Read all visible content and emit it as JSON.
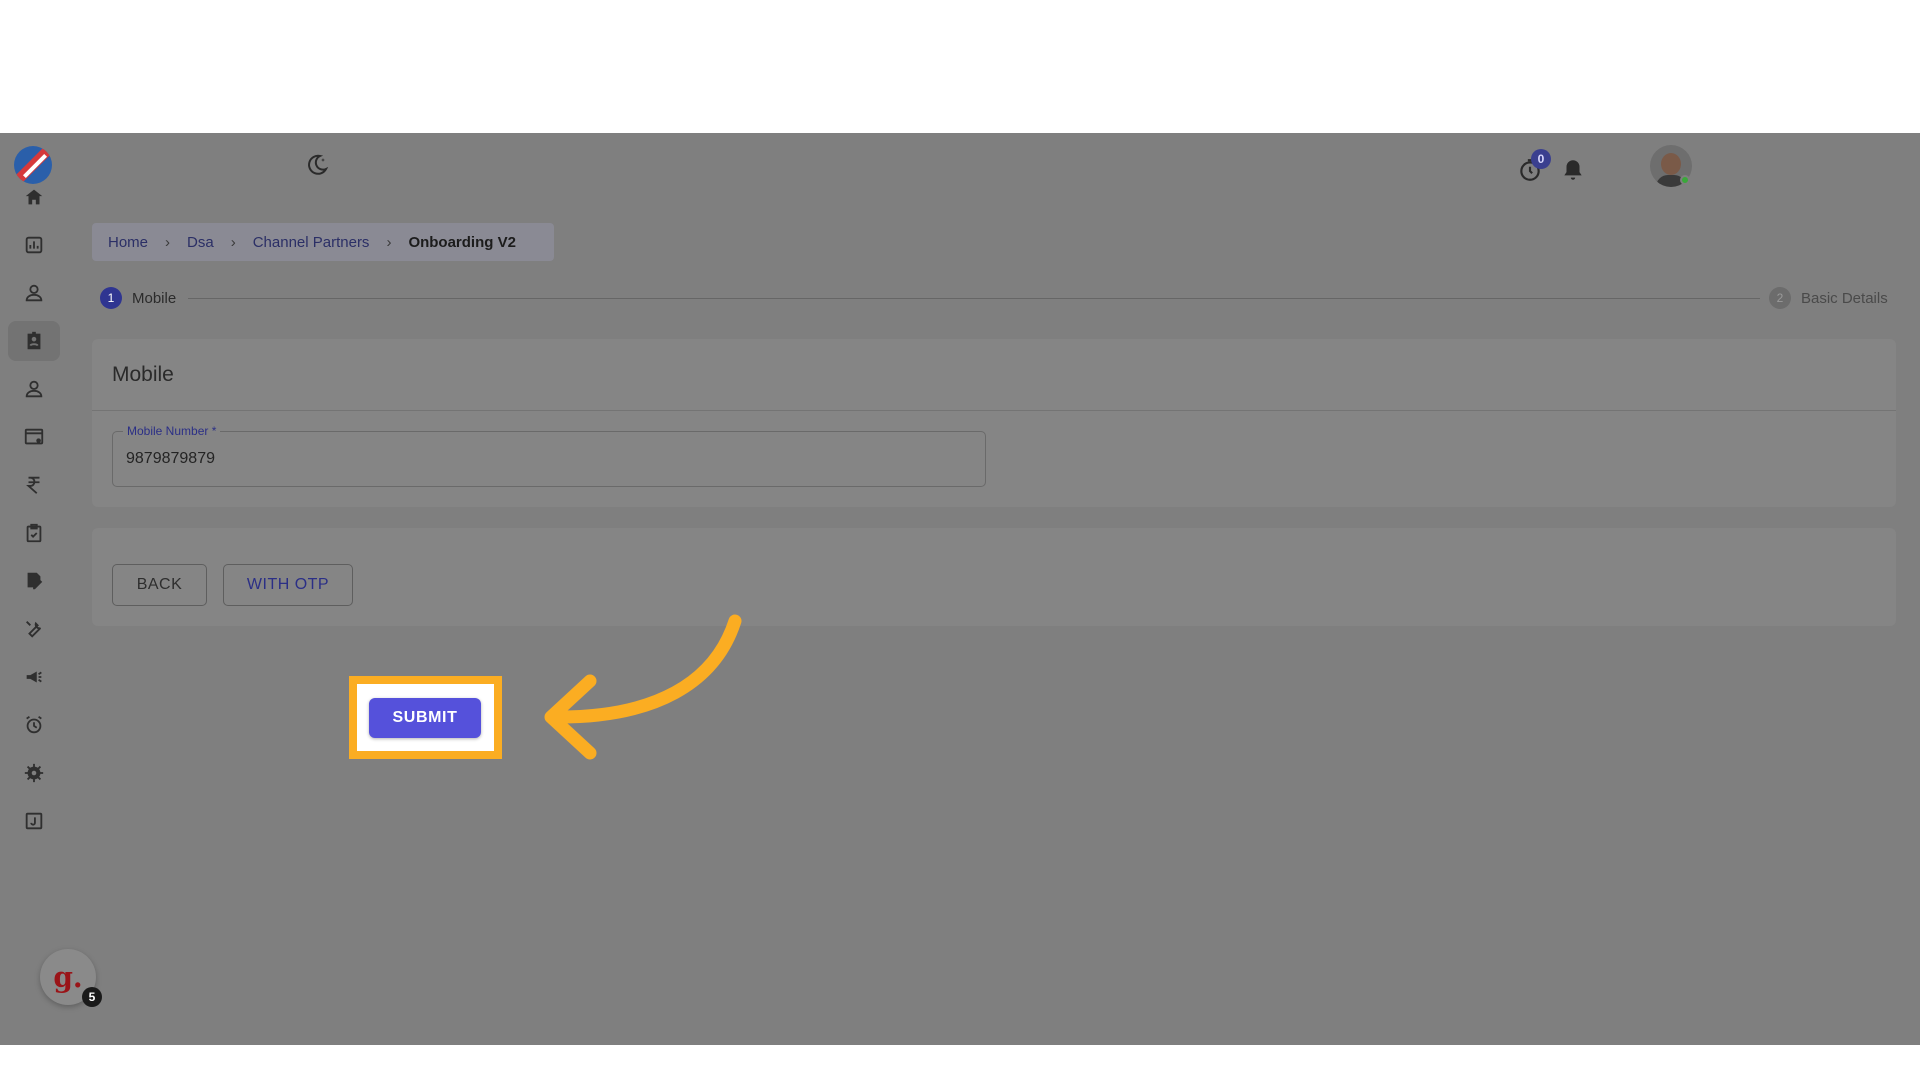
{
  "header": {
    "timer_count": "0"
  },
  "breadcrumb": {
    "items": [
      "Home",
      "Dsa",
      "Channel Partners"
    ],
    "current": "Onboarding V2"
  },
  "stepper": {
    "steps": [
      {
        "number": "1",
        "label": "Mobile"
      },
      {
        "number": "2",
        "label": "Basic Details"
      }
    ]
  },
  "mobile_card": {
    "title": "Mobile",
    "field_label": "Mobile Number *",
    "field_value": "9879879879"
  },
  "actions": {
    "back_label": "BACK",
    "otp_label": "WITH OTP",
    "submit_label": "SUBMIT"
  },
  "widget": {
    "letter": "g.",
    "badge": "5"
  },
  "colors": {
    "overlay": "#7f7f7f",
    "primary": "#5551db",
    "highlight": "#fbad22"
  },
  "icons": {
    "sidebar": [
      "home-icon",
      "dashboard-icon",
      "user-icon",
      "badge-icon",
      "person-icon",
      "settings-window-icon",
      "rupee-icon",
      "clipboard-check-icon",
      "edit-document-icon",
      "wrench-icon",
      "campaign-icon",
      "alarm-icon",
      "gear-icon",
      "j-box-icon"
    ],
    "topbar": [
      "moon-icon",
      "timer-icon",
      "bell-icon",
      "avatar"
    ]
  }
}
